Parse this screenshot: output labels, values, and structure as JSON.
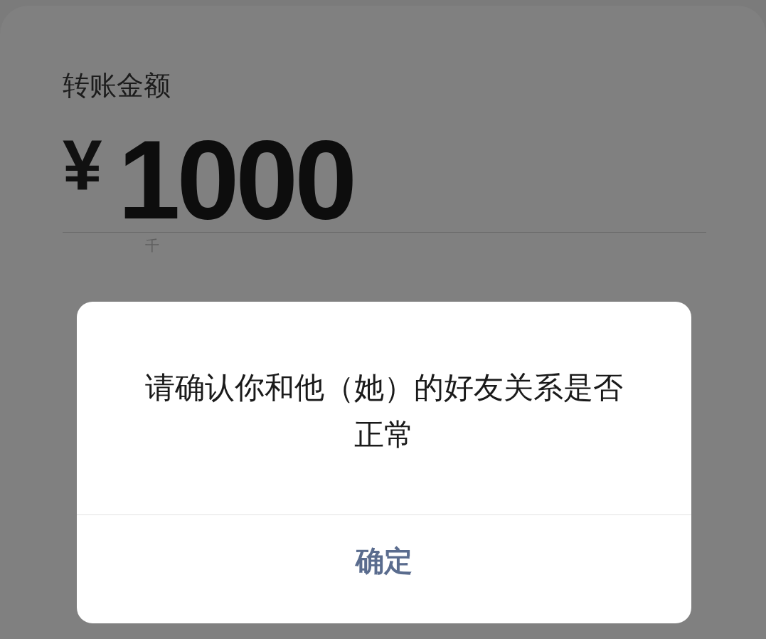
{
  "transfer": {
    "label": "转账金额",
    "currency": "¥",
    "amount": "1000",
    "unit_hint": "千"
  },
  "dialog": {
    "message": "请确认你和他（她）的好友关系是否正常",
    "button": "确定"
  }
}
